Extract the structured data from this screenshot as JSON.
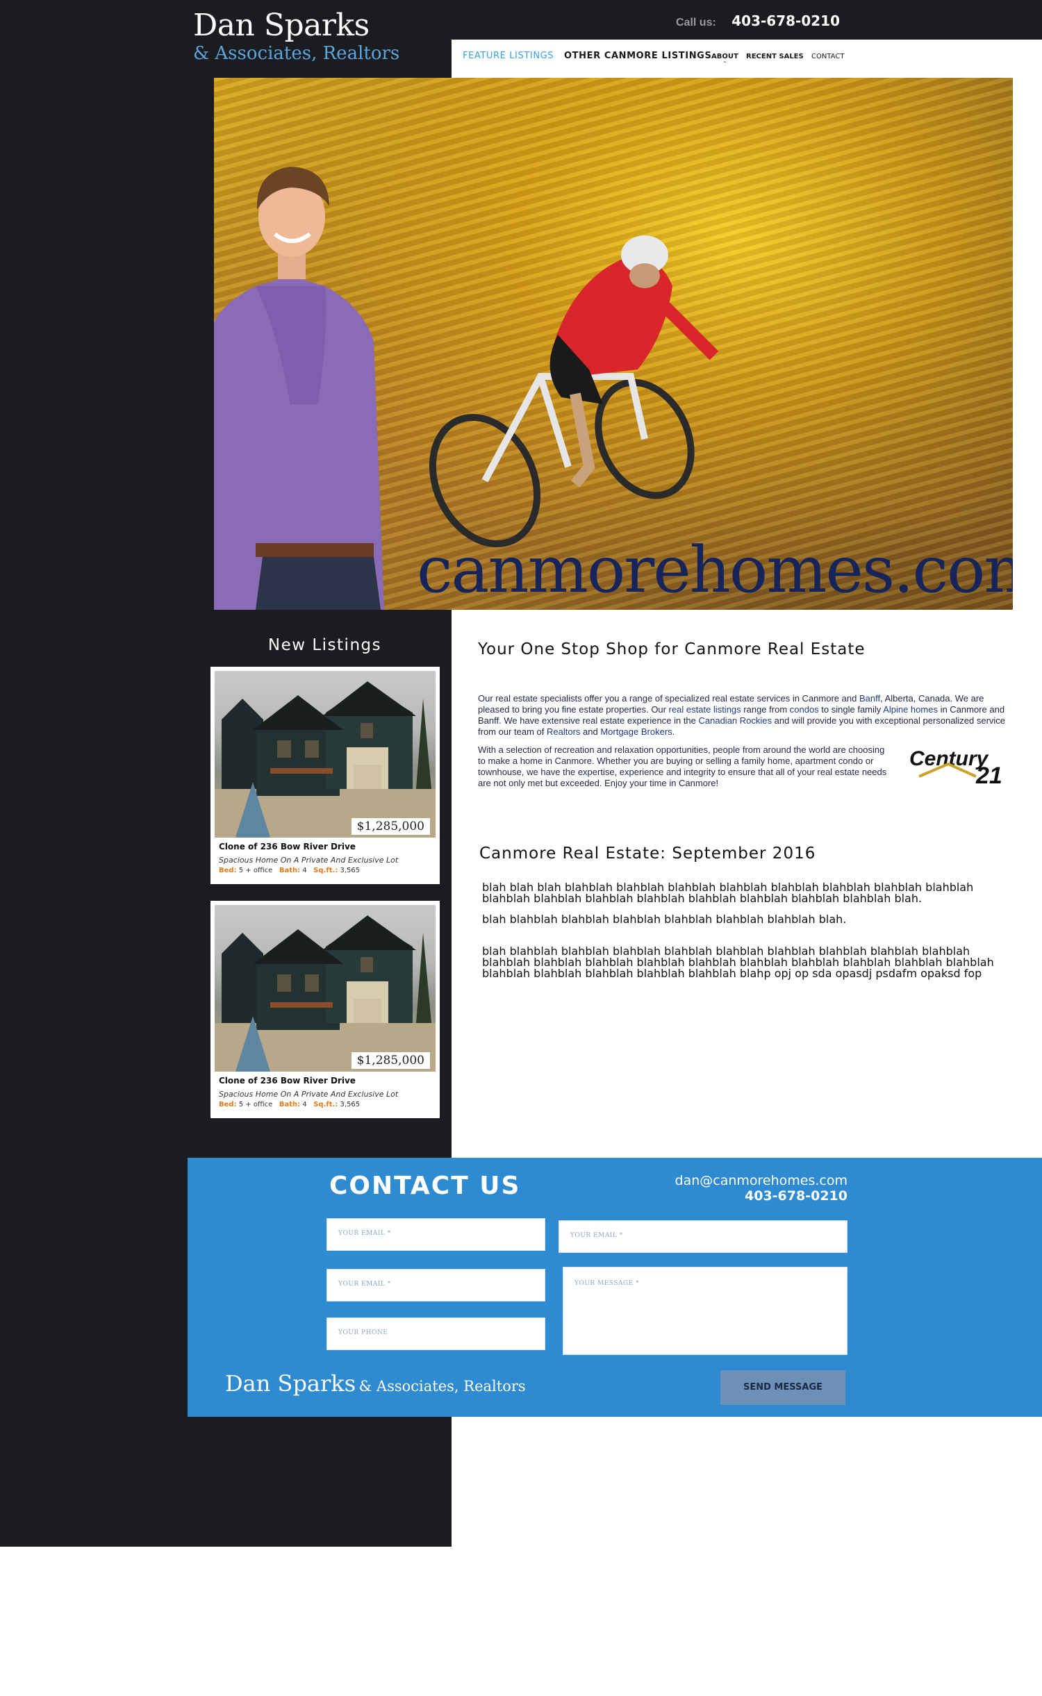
{
  "brand": {
    "name_line1": "Dan Sparks",
    "name_line2": "& Associates, Realtors"
  },
  "header": {
    "call_label": "Call us:",
    "phone": "403-678-0210"
  },
  "nav": {
    "items": [
      {
        "label": "FEATURE LISTINGS"
      },
      {
        "label": "OTHER CANMORE LISTINGS"
      },
      {
        "label": "ABOUT",
        "caret": "ˇ"
      },
      {
        "label": "RECENT SALES"
      },
      {
        "label": "CONTACT"
      }
    ]
  },
  "hero": {
    "watermark": "canmorehomes.com"
  },
  "new_listings": {
    "title": "New Listings",
    "cards": [
      {
        "price": "$1,285,000",
        "title": "Clone of 236 Bow River Drive",
        "subtitle": "Spacious Home On A Private And Exclusive Lot",
        "bed_label": "Bed:",
        "bed_value": "5 + office",
        "bath_label": "Bath:",
        "bath_value": "4",
        "sqft_label": "Sq.ft.:",
        "sqft_value": "3,565"
      },
      {
        "price": "$1,285,000",
        "title": "Clone of 236 Bow River Drive",
        "subtitle": "Spacious Home On A Private And Exclusive Lot",
        "bed_label": "Bed:",
        "bed_value": "5 + office",
        "bath_label": "Bath:",
        "bath_value": "4",
        "sqft_label": "Sq.ft.:",
        "sqft_value": "3,565"
      }
    ]
  },
  "main": {
    "heading": "Your One Stop Shop for Canmore Real Estate",
    "intro_p1": {
      "t1": "Our real estate specialists offer you a range of specialized real estate services in Canmore and ",
      "l1": "Banff",
      "t2": ", Alberta, Canada.  We are pleased to bring you fine estate properties.  Our ",
      "l2": "real estate listings",
      "t3": " range from ",
      "l3": "condos",
      "t4": " to single family ",
      "l4": "Alpine homes",
      "t5": " in Canmore and Banff.  We have extensive real estate experience in the ",
      "l5": "Canadian Rockies",
      "t6": " and will provide you with exceptional personalized service from our team of ",
      "l6": "Realtors",
      "t7": " and ",
      "l7": "Mortgage Brokers",
      "t8": "."
    },
    "intro_p2": "With a selection of recreation and relaxation opportunities, people from around the world are choosing to make a home in Canmore.  Whether you are buying or selling a family home, apartment condo or townhouse, we have the expertise, experience and integrity to ensure that all of your real estate needs are not only met but exceeded.  Enjoy your time in Canmore!",
    "century21": {
      "word": "Century",
      "num": "21"
    },
    "section_heading": "Canmore Real Estate: September 2016",
    "paragraphs": [
      "blah blah blah blahblah blahblah blahblah blahblah blahblah blahblah blahblah blahblah blahblah blahblah blahblah blahblah blahblah blahblah blahblah blahblah blah.",
      "blah blahblah blahblah blahblah blahblah blahblah blahblah blah.",
      "blah blahblah blahblah blahblah blahblah blahblah blahblah blahblah blahblah blahblah blahblah blahblah blahblah blahblah blahblah blahblah blahblah blahblah blahblah blahblah blahblah blahblah blahblah blahblah blahblah blahp opj op sda opasdj psdafm opaksd fop"
    ]
  },
  "contact": {
    "title": "CONTACT US",
    "email": "dan@canmorehomes.com",
    "phone": "403-678-0210",
    "fields": {
      "email1": "YOUR EMAIL *",
      "email2": "YOUR EMAIL *",
      "phone": "YOUR PHONE",
      "email_right": "YOUR EMAIL *",
      "message": "YOUR MESSAGE *"
    },
    "send_label": "SEND MESSAGE",
    "footer_logo_a": "Dan Sparks",
    "footer_logo_b": "& Associates, Realtors"
  }
}
